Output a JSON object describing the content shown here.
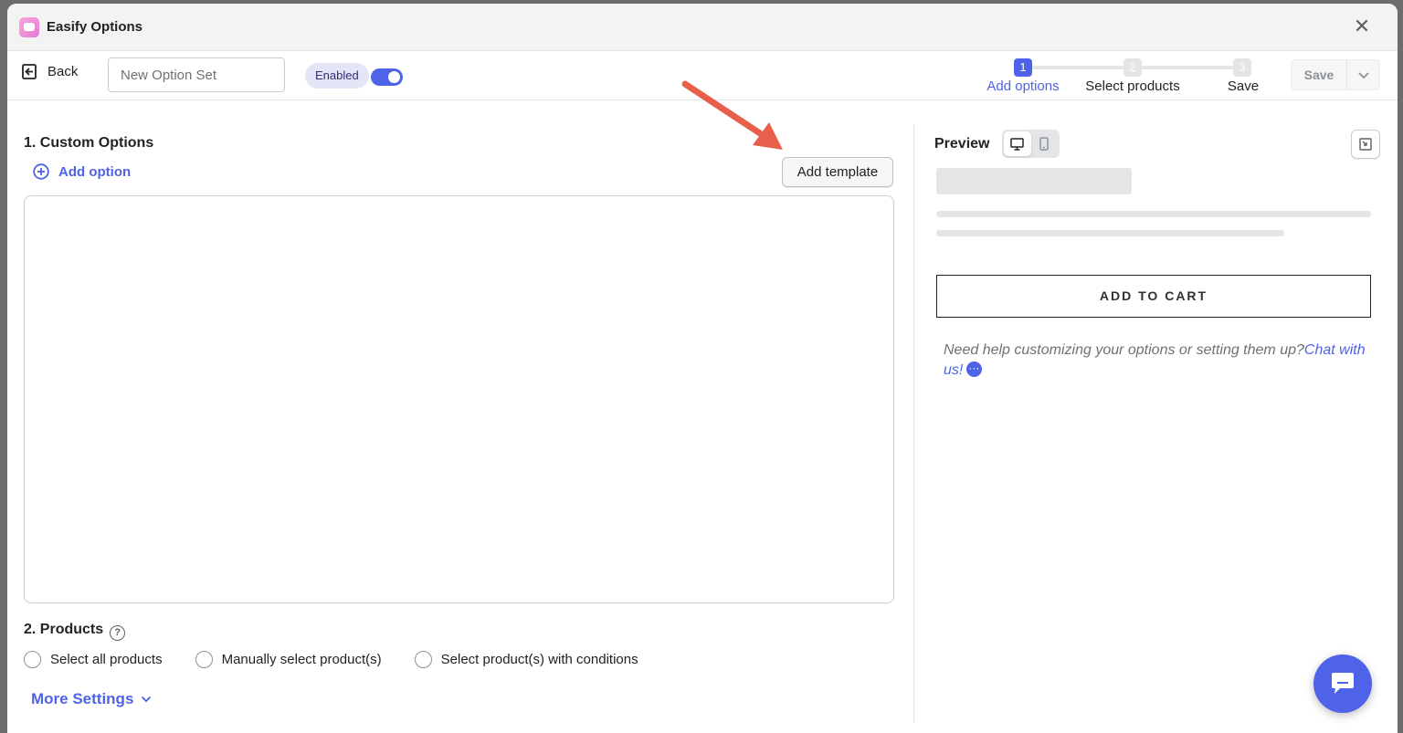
{
  "window": {
    "title": "Easify Options",
    "icon": "easify-app-icon",
    "close_icon": "close-icon"
  },
  "toolbar": {
    "back_label": "Back",
    "name_placeholder": "New Option Set",
    "name_value": "",
    "status_badge": "Enabled",
    "enabled": true,
    "steps": [
      {
        "number": "1",
        "label": "Add options",
        "active": true
      },
      {
        "number": "2",
        "label": "Select products",
        "active": false
      },
      {
        "number": "3",
        "label": "Save",
        "active": false
      }
    ],
    "save_label": "Save"
  },
  "custom_options": {
    "title": "1. Custom Options",
    "add_option_label": "Add option",
    "add_template_label": "Add template"
  },
  "products": {
    "title": "2. Products",
    "help_icon": "?",
    "radios": [
      {
        "label": "Select all products",
        "selected": false
      },
      {
        "label": "Manually select product(s)",
        "selected": false
      },
      {
        "label": "Select product(s) with conditions",
        "selected": false
      }
    ],
    "more_settings_label": "More Settings"
  },
  "preview": {
    "title": "Preview",
    "add_to_cart_label": "ADD TO CART",
    "help_text": "Need help customizing your options or setting them up?",
    "help_link": "Chat with us!"
  },
  "colors": {
    "accent": "#4f63e8",
    "annotation_arrow": "#e8604c"
  }
}
